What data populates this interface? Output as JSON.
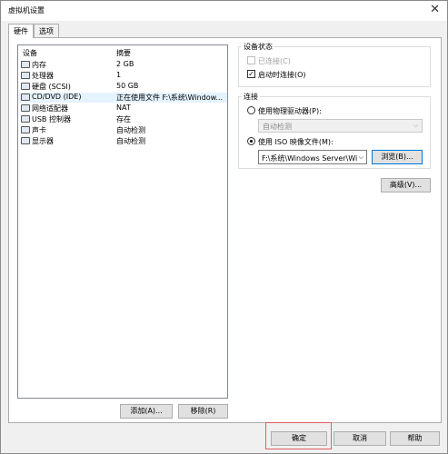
{
  "window": {
    "title": "虚拟机设置",
    "close_glyph": "✕"
  },
  "tabs": [
    {
      "label": "硬件"
    },
    {
      "label": "选项"
    }
  ],
  "device_list": {
    "header_device": "设备",
    "header_summary": "摘要",
    "items": [
      {
        "name": "内存",
        "summary": "2 GB",
        "icon": "memory-icon"
      },
      {
        "name": "处理器",
        "summary": "1",
        "icon": "processor-icon"
      },
      {
        "name": "硬盘 (SCSI)",
        "summary": "50 GB",
        "icon": "hard-disk-icon"
      },
      {
        "name": "CD/DVD (IDE)",
        "summary": "正在使用文件 F:\\系统\\Window...",
        "icon": "cd-dvd-icon"
      },
      {
        "name": "网络适配器",
        "summary": "NAT",
        "icon": "network-adapter-icon"
      },
      {
        "name": "USB 控制器",
        "summary": "存在",
        "icon": "usb-controller-icon"
      },
      {
        "name": "声卡",
        "summary": "自动检测",
        "icon": "sound-card-icon"
      },
      {
        "name": "显示器",
        "summary": "自动检测",
        "icon": "display-icon"
      }
    ],
    "selected_index": 3
  },
  "device_buttons": {
    "add": "添加(A)...",
    "remove": "移除(R)"
  },
  "device_status": {
    "title": "设备状态",
    "connected_label": "已连接(C)",
    "connected_checked": false,
    "connect_on_power_label": "启动时连接(O)",
    "connect_on_power_checked": true,
    "check_glyph": "✓"
  },
  "connection": {
    "title": "连接",
    "physical_label": "使用物理驱动器(P):",
    "physical_value": "自动检测",
    "iso_label": "使用 ISO 映像文件(M):",
    "iso_value": "F:\\系统\\Windows Server\\Wi",
    "browse": "浏览(B)...",
    "arrow_glyph": "⌵"
  },
  "advanced_button": "高级(V)...",
  "footer": {
    "ok": "确定",
    "cancel": "取消",
    "help": "帮助"
  }
}
